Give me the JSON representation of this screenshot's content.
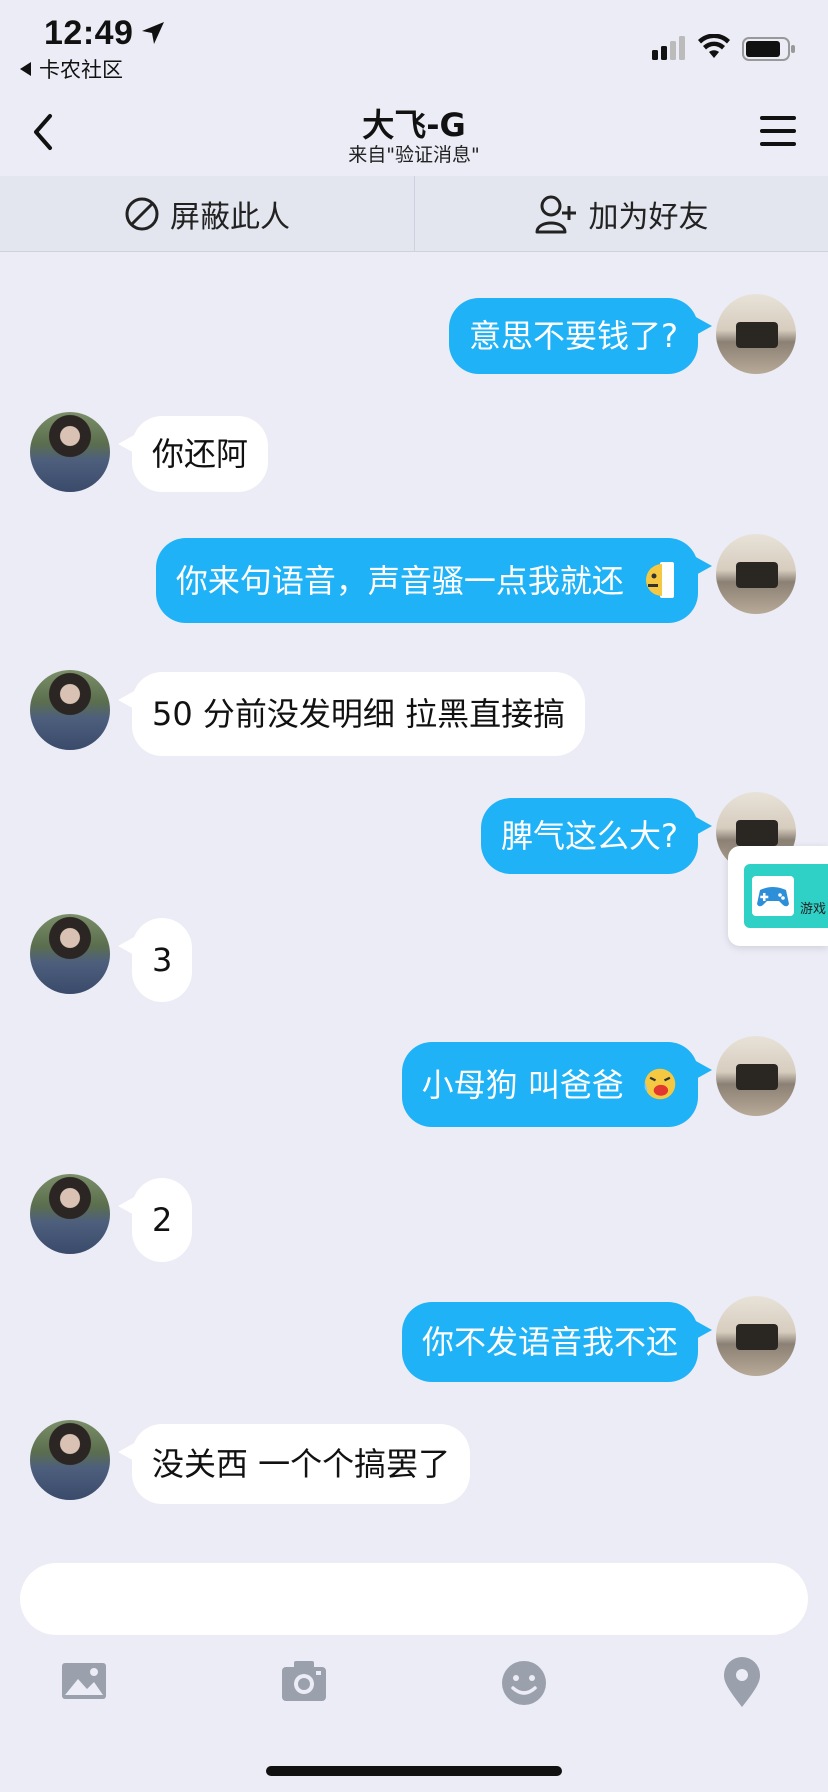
{
  "status": {
    "time": "12:49",
    "back_app": "卡农社区"
  },
  "nav": {
    "title": "大飞-G",
    "subtitle": "来自\"验证消息\""
  },
  "actions": {
    "block_label": "屏蔽此人",
    "add_friend_label": "加为好友"
  },
  "messages": [
    {
      "side": "out",
      "text": "意思不要钱了?"
    },
    {
      "side": "in",
      "text": "你还阿"
    },
    {
      "side": "out",
      "text": "你来句语音，声音骚一点我就还"
    },
    {
      "side": "in",
      "text": "50 分前没发明细 拉黑直接搞"
    },
    {
      "side": "out",
      "text": "脾气这么大?"
    },
    {
      "side": "in",
      "text": "3"
    },
    {
      "side": "out",
      "text": "小母狗 叫爸爸"
    },
    {
      "side": "in",
      "text": "2"
    },
    {
      "side": "out",
      "text": "你不发语音我不还"
    },
    {
      "side": "in",
      "text": "没关西 一个个搞罢了"
    }
  ],
  "game_float": {
    "label": "游戏"
  },
  "input": {
    "placeholder": ""
  },
  "toolbar": {
    "items": [
      "image-icon",
      "camera-icon",
      "emoji-icon",
      "location-icon"
    ]
  },
  "colors": {
    "background": "#ebecf5",
    "outgoing_bubble": "#1fb2f7",
    "incoming_bubble": "#ffffff",
    "game_tile": "#2fd0c6"
  }
}
